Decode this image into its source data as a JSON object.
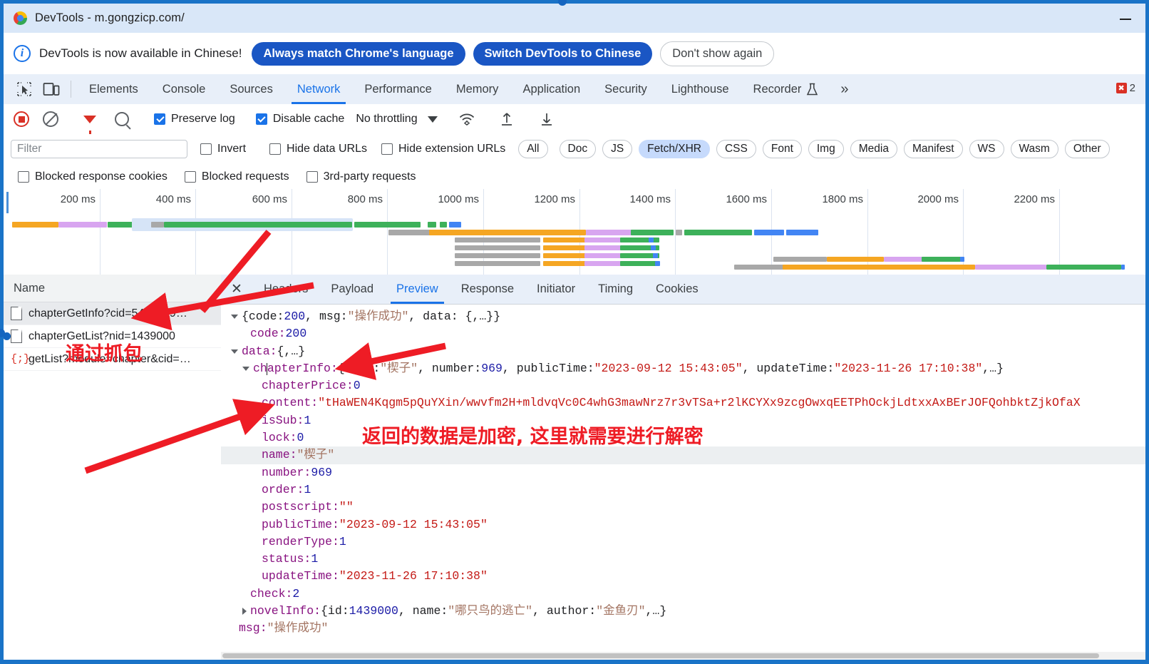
{
  "window": {
    "title": "DevTools - m.gongzicp.com/",
    "minimize_label": "–",
    "logo_name": "chrome-logo"
  },
  "banner": {
    "icon": "info-icon",
    "message": "DevTools is now available in Chinese!",
    "primary_button": "Always match Chrome's language",
    "secondary_button": "Switch DevTools to Chinese",
    "dismiss_button": "Don't show again"
  },
  "main_tabs": {
    "inspect_icon": "inspect-element-icon",
    "device_icon": "device-toolbar-icon",
    "items": [
      {
        "label": "Elements",
        "active": false
      },
      {
        "label": "Console",
        "active": false
      },
      {
        "label": "Sources",
        "active": false
      },
      {
        "label": "Network",
        "active": true
      },
      {
        "label": "Performance",
        "active": false
      },
      {
        "label": "Memory",
        "active": false
      },
      {
        "label": "Application",
        "active": false
      },
      {
        "label": "Security",
        "active": false
      },
      {
        "label": "Lighthouse",
        "active": false
      },
      {
        "label": "Recorder",
        "active": false
      }
    ],
    "recorder_icon": "flask-icon",
    "more_label": "»",
    "error_badge": {
      "icon": "error-square-icon",
      "count": "2"
    }
  },
  "network_toolbar": {
    "record_icon": "record-stop-icon",
    "clear_icon": "clear-icon",
    "filter_icon": "filter-funnel-icon",
    "search_icon": "search-icon",
    "preserve_log": {
      "label": "Preserve log",
      "checked": true
    },
    "disable_cache": {
      "label": "Disable cache",
      "checked": true
    },
    "throttling": "No throttling",
    "throttle_caret": "chevron-down-icon",
    "wifi_icon": "network-conditions-icon",
    "import_icon": "import-har-icon",
    "export_icon": "export-har-icon"
  },
  "filter_row": {
    "placeholder": "Filter",
    "value": "",
    "invert": {
      "label": "Invert",
      "checked": false
    },
    "hide_data_urls": {
      "label": "Hide data URLs",
      "checked": false
    },
    "hide_extension_urls": {
      "label": "Hide extension URLs",
      "checked": false
    },
    "types": [
      {
        "label": "All",
        "selected": false
      },
      {
        "label": "Doc",
        "selected": false
      },
      {
        "label": "JS",
        "selected": false
      },
      {
        "label": "Fetch/XHR",
        "selected": true
      },
      {
        "label": "CSS",
        "selected": false
      },
      {
        "label": "Font",
        "selected": false
      },
      {
        "label": "Img",
        "selected": false
      },
      {
        "label": "Media",
        "selected": false
      },
      {
        "label": "Manifest",
        "selected": false
      },
      {
        "label": "WS",
        "selected": false
      },
      {
        "label": "Wasm",
        "selected": false
      },
      {
        "label": "Other",
        "selected": false
      }
    ]
  },
  "blocked_row": {
    "blocked_response_cookies": {
      "label": "Blocked response cookies",
      "checked": false
    },
    "blocked_requests": {
      "label": "Blocked requests",
      "checked": false
    },
    "third_party_requests": {
      "label": "3rd-party requests",
      "checked": false
    }
  },
  "overview": {
    "tick_labels": [
      "200 ms",
      "400 ms",
      "600 ms",
      "800 ms",
      "1000 ms",
      "1200 ms",
      "1400 ms",
      "1600 ms",
      "1800 ms",
      "2000 ms",
      "2200 ms"
    ],
    "colors": {
      "orange": "#f5a623",
      "purple": "#d8a5f0",
      "green": "#3db15a",
      "blue": "#4285f4",
      "gray": "#a8a8a8",
      "selection": "#d6e4f7"
    }
  },
  "requests_panel": {
    "column_header": "Name",
    "rows": [
      {
        "name": "chapterGetInfo?cid=5454109…",
        "icon": "document-icon",
        "selected": true,
        "marker": false
      },
      {
        "name": "chapterGetList?nid=1439000",
        "icon": "document-icon",
        "selected": false,
        "marker": true
      },
      {
        "name": "getList?module=chapter&cid=…",
        "icon": "json-icon",
        "selected": false,
        "marker": false
      }
    ]
  },
  "details_panel": {
    "close_icon": "close-icon",
    "tabs": [
      {
        "label": "Headers",
        "active": false
      },
      {
        "label": "Payload",
        "active": false
      },
      {
        "label": "Preview",
        "active": true
      },
      {
        "label": "Response",
        "active": false
      },
      {
        "label": "Initiator",
        "active": false
      },
      {
        "label": "Timing",
        "active": false
      },
      {
        "label": "Cookies",
        "active": false
      }
    ],
    "json_lines": [
      {
        "indent": 0,
        "tri": "open",
        "parts": [
          {
            "t": "{code: ",
            "c": "p"
          },
          {
            "t": "200",
            "c": "n"
          },
          {
            "t": ", msg: ",
            "c": "p"
          },
          {
            "t": "\"操作成功\"",
            "c": "cjk"
          },
          {
            "t": ", data: {,…}}",
            "c": "p"
          }
        ]
      },
      {
        "indent": 1,
        "tri": "none",
        "parts": [
          {
            "t": "code: ",
            "c": "k"
          },
          {
            "t": "200",
            "c": "n"
          }
        ]
      },
      {
        "indent": 0,
        "tri": "open",
        "parts": [
          {
            "t": "data: ",
            "c": "k"
          },
          {
            "t": "{,…}",
            "c": "p"
          }
        ]
      },
      {
        "indent": 1,
        "tri": "open",
        "parts": [
          {
            "t": "chapterInfo: ",
            "c": "k"
          },
          {
            "t": "{name: ",
            "c": "p"
          },
          {
            "t": "\"楔子\"",
            "c": "cjk"
          },
          {
            "t": ", number: ",
            "c": "p"
          },
          {
            "t": "969",
            "c": "n"
          },
          {
            "t": ", publicTime: ",
            "c": "p"
          },
          {
            "t": "\"2023-09-12 15:43:05\"",
            "c": "s"
          },
          {
            "t": ", updateTime: ",
            "c": "p"
          },
          {
            "t": "\"2023-11-26 17:10:38\"",
            "c": "s"
          },
          {
            "t": ",…}",
            "c": "p"
          }
        ]
      },
      {
        "indent": 2,
        "tri": "none",
        "parts": [
          {
            "t": "chapterPrice: ",
            "c": "k"
          },
          {
            "t": "0",
            "c": "n"
          }
        ]
      },
      {
        "indent": 2,
        "tri": "none",
        "parts": [
          {
            "t": "content: ",
            "c": "k"
          },
          {
            "t": "\"tHaWEN4Kqgm5pQuYXin/wwvfm2H+mldvqVc0C4whG3mawNrz7r3vTSa+r2lKCYXx9zcgOwxqEETPhOckjLdtxxAxBErJOFQohbktZjkOfaX",
            "c": "s"
          }
        ]
      },
      {
        "indent": 2,
        "tri": "none",
        "parts": [
          {
            "t": "isSub: ",
            "c": "k"
          },
          {
            "t": "1",
            "c": "n"
          }
        ]
      },
      {
        "indent": 2,
        "tri": "none",
        "parts": [
          {
            "t": "lock: ",
            "c": "k"
          },
          {
            "t": "0",
            "c": "n"
          }
        ]
      },
      {
        "indent": 2,
        "tri": "none",
        "hl": true,
        "parts": [
          {
            "t": "name: ",
            "c": "k"
          },
          {
            "t": "\"楔子\"",
            "c": "cjk"
          }
        ]
      },
      {
        "indent": 2,
        "tri": "none",
        "parts": [
          {
            "t": "number: ",
            "c": "k"
          },
          {
            "t": "969",
            "c": "n"
          }
        ]
      },
      {
        "indent": 2,
        "tri": "none",
        "parts": [
          {
            "t": "order: ",
            "c": "k"
          },
          {
            "t": "1",
            "c": "n"
          }
        ]
      },
      {
        "indent": 2,
        "tri": "none",
        "parts": [
          {
            "t": "postscript: ",
            "c": "k"
          },
          {
            "t": "\"\"",
            "c": "s"
          }
        ]
      },
      {
        "indent": 2,
        "tri": "none",
        "parts": [
          {
            "t": "publicTime: ",
            "c": "k"
          },
          {
            "t": "\"2023-09-12 15:43:05\"",
            "c": "s"
          }
        ]
      },
      {
        "indent": 2,
        "tri": "none",
        "parts": [
          {
            "t": "renderType: ",
            "c": "k"
          },
          {
            "t": "1",
            "c": "n"
          }
        ]
      },
      {
        "indent": 2,
        "tri": "none",
        "parts": [
          {
            "t": "status: ",
            "c": "k"
          },
          {
            "t": "1",
            "c": "n"
          }
        ]
      },
      {
        "indent": 2,
        "tri": "none",
        "parts": [
          {
            "t": "updateTime: ",
            "c": "k"
          },
          {
            "t": "\"2023-11-26 17:10:38\"",
            "c": "s"
          }
        ]
      },
      {
        "indent": 1,
        "tri": "none",
        "parts": [
          {
            "t": "check: ",
            "c": "k"
          },
          {
            "t": "2",
            "c": "n"
          }
        ]
      },
      {
        "indent": 1,
        "tri": "closed",
        "parts": [
          {
            "t": "novelInfo: ",
            "c": "k"
          },
          {
            "t": "{id: ",
            "c": "p"
          },
          {
            "t": "1439000",
            "c": "n"
          },
          {
            "t": ", name: ",
            "c": "p"
          },
          {
            "t": "\"哪只鸟的逃亡\"",
            "c": "cjk"
          },
          {
            "t": ", author: ",
            "c": "p"
          },
          {
            "t": "\"金鱼刃\"",
            "c": "cjk"
          },
          {
            "t": ",…}",
            "c": "p"
          }
        ]
      },
      {
        "indent": 0,
        "tri": "none",
        "parts": [
          {
            "t": "msg: ",
            "c": "k"
          },
          {
            "t": "\"操作成功\"",
            "c": "cjk"
          }
        ]
      }
    ]
  },
  "annotations": {
    "color": "#ee1c25",
    "note_capture": "通过抓包",
    "note_encrypted": "返回的数据是加密, 这里就需要进行解密"
  }
}
